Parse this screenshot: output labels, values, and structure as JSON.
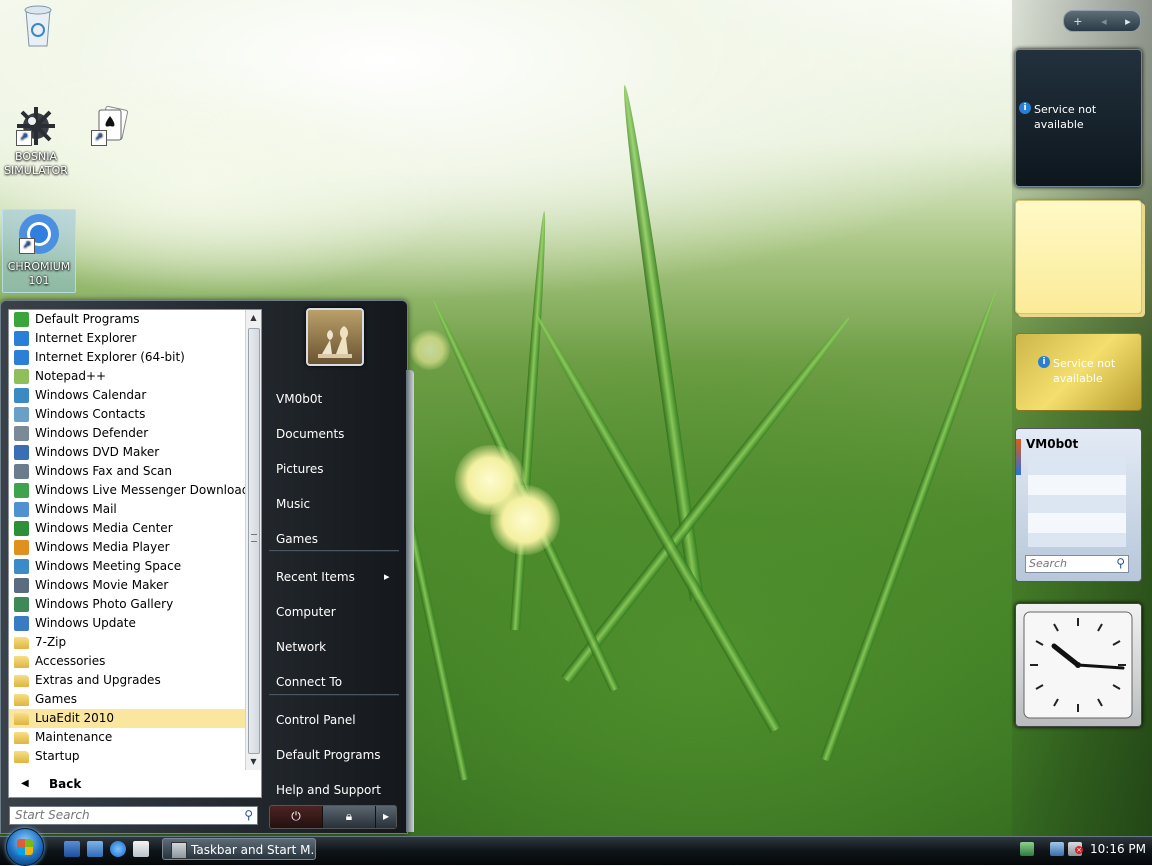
{
  "desktop": {
    "icons": [
      {
        "label": "",
        "icon": "recycle-bin-icon"
      },
      {
        "label": "BOSNIA SIMULATOR",
        "icon": "mine-icon"
      },
      {
        "label": "",
        "icon": "solitaire-cards-icon"
      },
      {
        "label": "CHROMIUM 101",
        "icon": "chromium-icon"
      }
    ]
  },
  "sidebar": {
    "controls": {
      "add": "+",
      "prev": "◂",
      "next": "▸"
    },
    "feed_gadget": {
      "message": "Service not available"
    },
    "currency_gadget": {
      "message": "Service not available"
    },
    "contacts_gadget": {
      "title": "VM0b0t",
      "search_placeholder": "Search"
    },
    "clock_gadget": {
      "time": "10:16"
    }
  },
  "start_menu": {
    "programs": [
      {
        "label": "Default Programs",
        "icon": "default-programs-icon",
        "color": "#3aa53a"
      },
      {
        "label": "Internet Explorer",
        "icon": "ie-icon",
        "color": "#2c7fd6"
      },
      {
        "label": "Internet Explorer (64-bit)",
        "icon": "ie-icon",
        "color": "#2c7fd6"
      },
      {
        "label": "Notepad++",
        "icon": "notepad-icon",
        "color": "#8fbf5a"
      },
      {
        "label": "Windows Calendar",
        "icon": "calendar-icon",
        "color": "#3b8ac4"
      },
      {
        "label": "Windows Contacts",
        "icon": "contacts-icon",
        "color": "#6aa0c8"
      },
      {
        "label": "Windows Defender",
        "icon": "defender-icon",
        "color": "#7b8a96"
      },
      {
        "label": "Windows DVD Maker",
        "icon": "dvd-icon",
        "color": "#3a6fb5"
      },
      {
        "label": "Windows Fax and Scan",
        "icon": "fax-icon",
        "color": "#6b7c8c"
      },
      {
        "label": "Windows Live Messenger Download",
        "icon": "messenger-icon",
        "color": "#3fa34d"
      },
      {
        "label": "Windows Mail",
        "icon": "mail-icon",
        "color": "#4f91d1"
      },
      {
        "label": "Windows Media Center",
        "icon": "media-center-icon",
        "color": "#2d8f3a"
      },
      {
        "label": "Windows Media Player",
        "icon": "media-player-icon",
        "color": "#e0901f"
      },
      {
        "label": "Windows Meeting Space",
        "icon": "meeting-icon",
        "color": "#3a8bc7"
      },
      {
        "label": "Windows Movie Maker",
        "icon": "movie-icon",
        "color": "#5a6d80"
      },
      {
        "label": "Windows Photo Gallery",
        "icon": "photo-icon",
        "color": "#3d8a56"
      },
      {
        "label": "Windows Update",
        "icon": "update-icon",
        "color": "#3a7cc3"
      },
      {
        "label": "7-Zip",
        "icon": "folder-icon",
        "color": ""
      },
      {
        "label": "Accessories",
        "icon": "folder-icon",
        "color": ""
      },
      {
        "label": "Extras and Upgrades",
        "icon": "folder-icon",
        "color": ""
      },
      {
        "label": "Games",
        "icon": "folder-icon",
        "color": ""
      },
      {
        "label": "LuaEdit 2010",
        "icon": "folder-icon",
        "color": "",
        "highlighted": true
      },
      {
        "label": "Maintenance",
        "icon": "folder-icon",
        "color": ""
      },
      {
        "label": "Startup",
        "icon": "folder-icon",
        "color": ""
      }
    ],
    "back_label": "Back",
    "search_placeholder": "Start Search",
    "right_items": [
      {
        "label": "VM0b0t"
      },
      {
        "label": "Documents"
      },
      {
        "label": "Pictures"
      },
      {
        "label": "Music"
      },
      {
        "label": "Games"
      },
      {
        "label": "Recent Items",
        "submenu": true
      },
      {
        "label": "Computer"
      },
      {
        "label": "Network"
      },
      {
        "label": "Connect To"
      },
      {
        "label": "Control Panel"
      },
      {
        "label": "Default Programs"
      },
      {
        "label": "Help and Support"
      }
    ]
  },
  "taskbar": {
    "window_button": "Taskbar and Start M...",
    "clock": "10:16 PM"
  }
}
